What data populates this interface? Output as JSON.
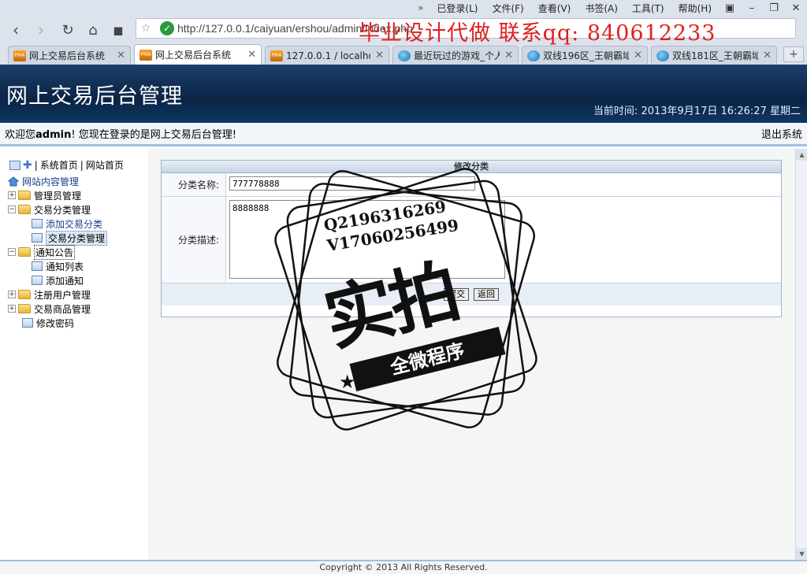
{
  "browser": {
    "menu": [
      "已登录(L)",
      "文件(F)",
      "查看(V)",
      "书签(A)",
      "工具(T)",
      "帮助(H)"
    ],
    "url": "http://127.0.0.1/caiyuan/ershou/admin/index.php",
    "tabs": [
      {
        "label": "网上交易后台系统",
        "icon": "pma"
      },
      {
        "label": "网上交易后台系统",
        "icon": "pma",
        "active": true
      },
      {
        "label": "127.0.0.1 / localhost /",
        "icon": "pma"
      },
      {
        "label": "最近玩过的游戏_个人",
        "icon": "globe"
      },
      {
        "label": "双线196区_王朝霸域_",
        "icon": "globe"
      },
      {
        "label": "双线181区_王朝霸域_",
        "icon": "globe"
      }
    ]
  },
  "overlay": {
    "banner": "毕业设计代做 联系qq: 840612233",
    "stamp_lines": [
      "Q2196316269",
      "V17060256499"
    ],
    "stamp_big": "实拍",
    "stamp_ribbon": "全微程序"
  },
  "header": {
    "title": "网上交易后台管理",
    "time_label": "当前时间:",
    "time_value": "2013年9月17日 16:26:27 星期二"
  },
  "welcome": {
    "prefix": "欢迎您",
    "user": "admin",
    "suffix": "! 您现在登录的是网上交易后台管理!",
    "logout": "退出系统"
  },
  "sidebar": {
    "top_links": [
      "系统首页",
      "网站首页"
    ],
    "root": "网站内容管理",
    "items": [
      {
        "label": "管理员管理",
        "level": 1,
        "type": "folder",
        "expander": "+"
      },
      {
        "label": "交易分类管理",
        "level": 1,
        "type": "folder",
        "expander": "-"
      },
      {
        "label": "添加交易分类",
        "level": 2,
        "type": "page"
      },
      {
        "label": "交易分类管理",
        "level": 2,
        "type": "page",
        "selected": true
      },
      {
        "label": "通知公告",
        "level": 1,
        "type": "folder",
        "expander": "-",
        "outlined": true
      },
      {
        "label": "通知列表",
        "level": 2,
        "type": "page"
      },
      {
        "label": "添加通知",
        "level": 2,
        "type": "page"
      },
      {
        "label": "注册用户管理",
        "level": 1,
        "type": "folder",
        "expander": "+"
      },
      {
        "label": "交易商品管理",
        "level": 1,
        "type": "folder",
        "expander": "+"
      },
      {
        "label": "修改密码",
        "level": 1,
        "type": "page"
      }
    ]
  },
  "form": {
    "title": "修改分类",
    "name_label": "分类名称:",
    "name_value": "777778888",
    "desc_label": "分类描述:",
    "desc_value": "8888888",
    "submit": "提交",
    "back": "返回"
  },
  "footer": {
    "copyright": "Copyright © 2013 All Rights Reserved."
  }
}
